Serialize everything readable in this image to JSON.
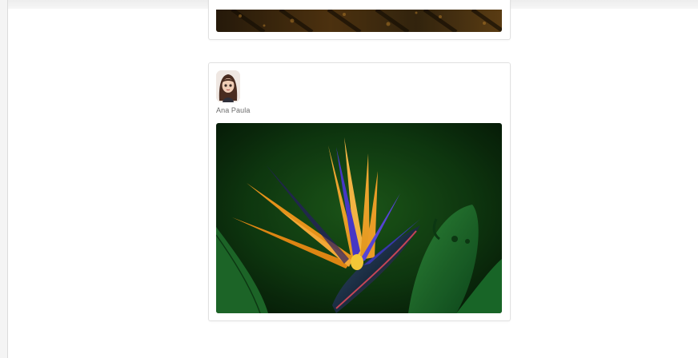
{
  "feed": {
    "posts": [
      {
        "author": "",
        "image": "crop-field-photo"
      },
      {
        "author": "Ana Paula",
        "avatar": "cartoon-woman-avatar",
        "image": "bird-of-paradise-flower-photo"
      }
    ]
  },
  "colors": {
    "card_border": "#e1e1e1",
    "author_text": "#6d6d6d",
    "page_background": "#ffffff"
  }
}
